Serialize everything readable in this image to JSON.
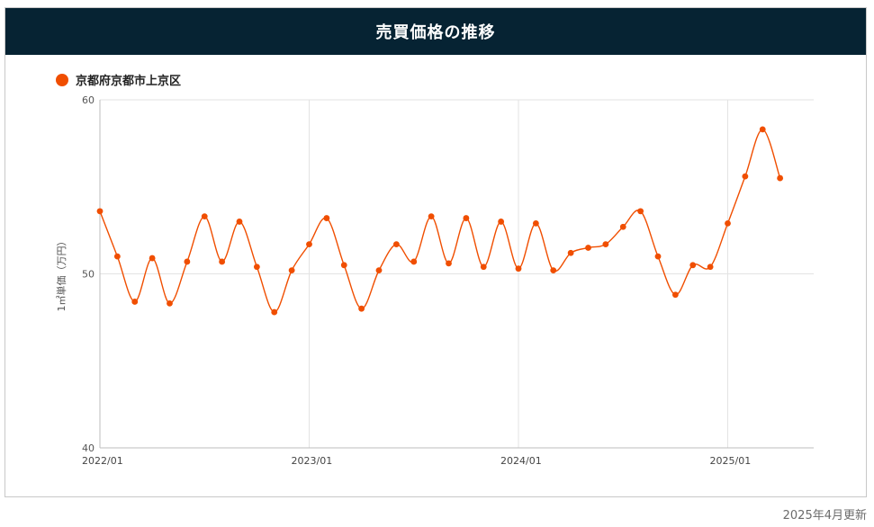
{
  "header": {
    "title": "売買価格の推移"
  },
  "colors": {
    "header_bg": "#062333",
    "series": "#f04e00",
    "grid": "#e3e3e3"
  },
  "footer": {
    "updated": "2025年4月更新"
  },
  "chart_data": {
    "type": "line",
    "ylabel": "1㎡単価（万円）",
    "xlabel": "",
    "ylim": [
      40,
      60
    ],
    "yticks": [
      40,
      50,
      60
    ],
    "xticks": [
      "2022/01",
      "2023/01",
      "2024/01",
      "2025/01"
    ],
    "grid": true,
    "legend_position": "top-left",
    "series": [
      {
        "name": "京都府京都市上京区",
        "x": [
          "2022/01",
          "2022/02",
          "2022/03",
          "2022/04",
          "2022/05",
          "2022/06",
          "2022/07",
          "2022/08",
          "2022/09",
          "2022/10",
          "2022/11",
          "2022/12",
          "2023/01",
          "2023/02",
          "2023/03",
          "2023/04",
          "2023/05",
          "2023/06",
          "2023/07",
          "2023/08",
          "2023/09",
          "2023/10",
          "2023/11",
          "2023/12",
          "2024/01",
          "2024/02",
          "2024/03",
          "2024/04",
          "2024/05",
          "2024/06",
          "2024/07",
          "2024/08",
          "2024/09",
          "2024/10",
          "2024/11",
          "2024/12",
          "2025/01",
          "2025/02",
          "2025/03",
          "2025/04"
        ],
        "values": [
          53.6,
          51.0,
          48.4,
          50.9,
          48.3,
          50.7,
          53.3,
          50.7,
          53.0,
          50.4,
          47.8,
          50.2,
          51.7,
          53.2,
          50.5,
          48.0,
          50.2,
          51.7,
          50.7,
          53.3,
          50.6,
          53.2,
          50.4,
          53.0,
          50.3,
          52.9,
          50.2,
          51.2,
          51.5,
          51.7,
          52.7,
          53.6,
          51.0,
          48.8,
          50.5,
          50.4,
          52.9,
          55.6,
          58.3,
          55.5
        ]
      }
    ]
  }
}
